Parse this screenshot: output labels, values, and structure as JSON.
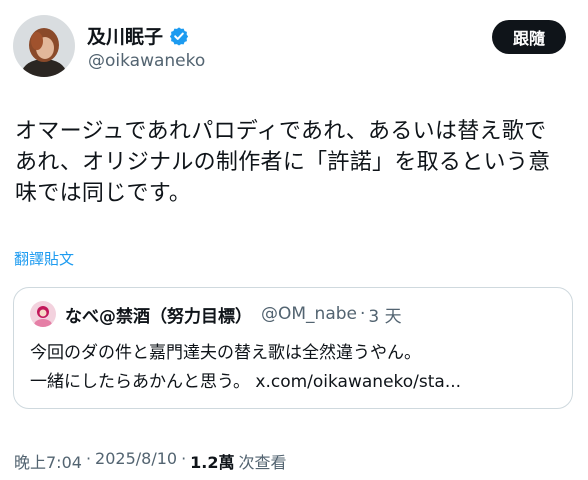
{
  "author": {
    "name": "及川眠子",
    "handle": "@oikawaneko",
    "verified_icon": "verified-badge-icon",
    "verified_color": "#1d9bf0"
  },
  "follow_label": "跟隨",
  "tweet": {
    "lines": [
      "オマージュであれパロディであれ、あるいは替え歌で",
      "あれ、オリジナルの制作者に「許諾」を取るという意",
      "味では同じです。"
    ]
  },
  "translate_label": "翻譯貼文",
  "quote": {
    "name": "なべ@禁酒（努力目標）",
    "handle": "@OM_nabe",
    "separator": "·",
    "time": "3 天",
    "lines": [
      "今回のダの件と嘉門達夫の替え歌は全然違うやん。",
      "一緒にしたらあかんと思う。 x.com/oikawaneko/sta..."
    ]
  },
  "meta": {
    "time": "晚上7:04",
    "date": "2025/8/10",
    "sep1": "·",
    "sep2": "·",
    "views": "1.2萬",
    "views_label": "次查看"
  },
  "colors": {
    "text": "#0f1419",
    "secondary": "#536471",
    "link": "#1d9bf0",
    "border": "#cfd9de"
  }
}
